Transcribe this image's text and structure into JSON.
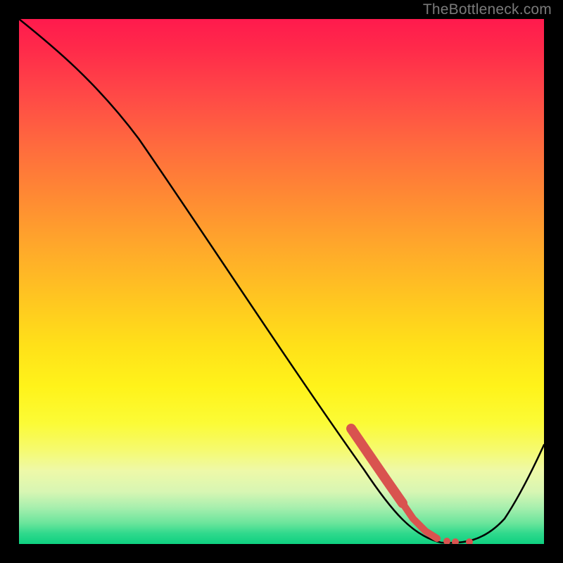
{
  "watermark": "TheBottleneck.com",
  "chart_data": {
    "type": "line",
    "title": "",
    "xlabel": "",
    "ylabel": "",
    "xlim": [
      0,
      100
    ],
    "ylim": [
      0,
      100
    ],
    "grid": false,
    "legend": false,
    "series": [
      {
        "name": "bottleneck-curve",
        "color": "#000000",
        "x": [
          0,
          10,
          20,
          30,
          40,
          50,
          60,
          70,
          75,
          78,
          82,
          86,
          90,
          100
        ],
        "y": [
          100,
          92,
          83,
          70,
          56,
          42,
          28,
          14,
          7,
          3,
          0,
          0,
          4,
          20
        ]
      },
      {
        "name": "highlighted-range",
        "color": "#d9534f",
        "x": [
          63,
          66,
          69,
          72,
          74,
          76,
          78,
          80,
          82,
          84
        ],
        "y": [
          23,
          19,
          15,
          11,
          8,
          5,
          3,
          1.5,
          0.5,
          0.5
        ]
      }
    ],
    "annotations": []
  },
  "colors": {
    "watermark": "#7a7a7a",
    "highlight": "#d9534f",
    "curve": "#000000",
    "frame": "#000000"
  }
}
